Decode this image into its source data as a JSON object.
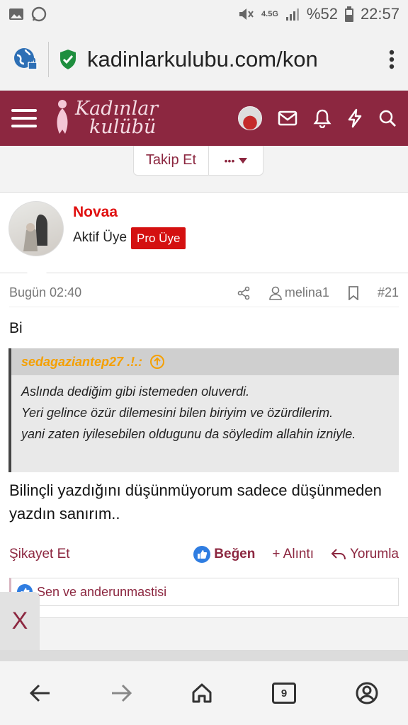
{
  "statusbar": {
    "network": "4.5G",
    "battery": "%52",
    "time": "22:57"
  },
  "browser": {
    "url": "kadinlarkulubu.com/kon"
  },
  "site": {
    "logo_line1": "Kadınlar",
    "logo_line2": "kulübü"
  },
  "thread": {
    "follow_label": "Takip Et",
    "more_label": "•••"
  },
  "user": {
    "name": "Novaa",
    "title": "Aktif Üye",
    "badge": "Pro Üye"
  },
  "post": {
    "time": "Bugün 02:40",
    "mention": "melina1",
    "number": "#21",
    "first_line": "Bi",
    "quote_author": "sedagaziantep27 .!.:",
    "quote_lines": [
      "Aslında dediğim gibi istemeden oluverdi.",
      "Yeri gelince özür dilemesini bilen biriyim ve özürdilerim.",
      "yani zaten iyilesebilen oldugunu da söyledim allahin izniyle."
    ],
    "body": "Bilinçli yazdığını düşünmüyorum sadece düşünmeden yazdın sanırım..",
    "report_label": "Şikayet Et",
    "like_label": "Beğen",
    "quote_label": "+ Alıntı",
    "reply_label": "Yorumla",
    "reactions": "Sen ve anderunmastisi"
  },
  "overlay": {
    "close_label": "X"
  },
  "bottom": {
    "tab_count": "9"
  }
}
